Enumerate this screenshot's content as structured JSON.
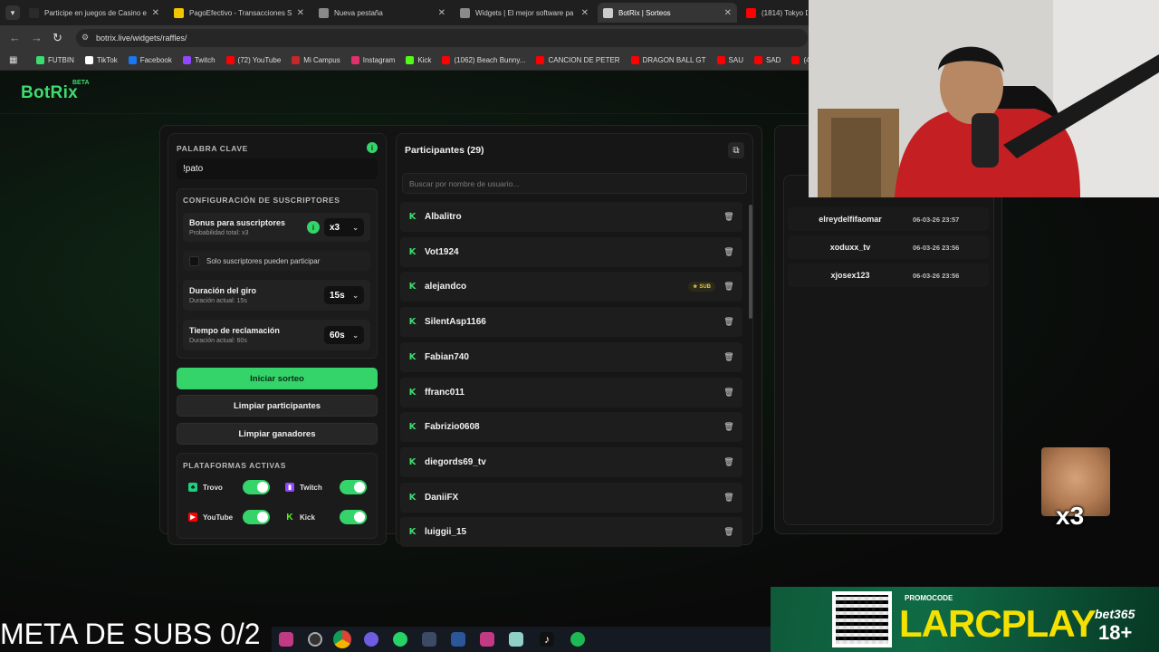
{
  "browser": {
    "tabs": [
      {
        "label": "Participe en juegos de Casino e",
        "fav_color": "#2b2b2b",
        "active": false
      },
      {
        "label": "PagoEfectivo - Transacciones S",
        "fav_color": "#f5c400",
        "active": false
      },
      {
        "label": "Nueva pestaña",
        "fav_color": "#8a8a8a",
        "active": false
      },
      {
        "label": "Widgets | El mejor software pa",
        "fav_color": "#8a8a8a",
        "active": false
      },
      {
        "label": "BotRix | Sorteos",
        "fav_color": "#cccccc",
        "active": true
      },
      {
        "label": "(1814) Tokyo D",
        "fav_color": "#ff0000",
        "active": false
      }
    ],
    "url": "botrix.live/widgets/raffles/",
    "bookmarks": [
      {
        "label": "FUTBIN",
        "color": "#3ddc6e"
      },
      {
        "label": "TikTok",
        "color": "#ffffff"
      },
      {
        "label": "Facebook",
        "color": "#1877f2"
      },
      {
        "label": "Twitch",
        "color": "#9146ff"
      },
      {
        "label": "(72) YouTube",
        "color": "#ff0000"
      },
      {
        "label": "Mi Campus",
        "color": "#c62828"
      },
      {
        "label": "Instagram",
        "color": "#e1306c"
      },
      {
        "label": "Kick",
        "color": "#53fc18"
      },
      {
        "label": "(1062) Beach Bunny...",
        "color": "#ff0000"
      },
      {
        "label": "CANCION DE PETER",
        "color": "#ff0000"
      },
      {
        "label": "DRAGON BALL GT",
        "color": "#ff0000"
      },
      {
        "label": "SAU",
        "color": "#ff0000"
      },
      {
        "label": "SAD",
        "color": "#ff0000"
      },
      {
        "label": "(463) J",
        "color": "#ff0000"
      }
    ]
  },
  "app": {
    "logo": "BotRix",
    "beta": "BETA",
    "accent": "#35d46a"
  },
  "settings": {
    "keyword_label": "PALABRA CLAVE",
    "keyword_value": "!pato",
    "subs_config_label": "CONFIGURACIÓN DE SUSCRIPTORES",
    "bonus_title": "Bonus para suscriptores",
    "bonus_sub": "Probabilidad total: x3",
    "bonus_value": "x3",
    "only_subs_label": "Solo suscriptores pueden participar",
    "spin_title": "Duración del giro",
    "spin_sub": "Duración actual: 15s",
    "spin_value": "15s",
    "claim_title": "Tiempo de reclamación",
    "claim_sub": "Duración actual: 60s",
    "claim_value": "60s",
    "start_button": "Iniciar sorteo",
    "clear_participants_button": "Limpiar participantes",
    "clear_winners_button": "Limpiar ganadores",
    "platforms_label": "PLATAFORMAS ACTIVAS",
    "platforms": [
      {
        "name": "Trovo",
        "color": "#1fcf7f",
        "on": true
      },
      {
        "name": "Twitch",
        "color": "#9146ff",
        "on": true
      },
      {
        "name": "YouTube",
        "color": "#ff0000",
        "on": true
      },
      {
        "name": "Kick",
        "color": "#53fc18",
        "on": true
      }
    ]
  },
  "participants": {
    "title": "Participantes (29)",
    "search_placeholder": "Buscar por nombre de usuario...",
    "sub_badge": "SUB",
    "list": [
      {
        "name": "Albalitro",
        "sub": false
      },
      {
        "name": "Vot1924",
        "sub": false
      },
      {
        "name": "alejandco",
        "sub": true
      },
      {
        "name": "SilentAsp1166",
        "sub": false
      },
      {
        "name": "Fabian740",
        "sub": false
      },
      {
        "name": "ffranc011",
        "sub": false
      },
      {
        "name": "Fabrizio0608",
        "sub": false
      },
      {
        "name": "diegords69_tv",
        "sub": false
      },
      {
        "name": "DaniiFX",
        "sub": false
      },
      {
        "name": "luiggii_15",
        "sub": false
      }
    ]
  },
  "winners": [
    {
      "name": "elreydelfifaomar",
      "date": "06-03-26 23:57"
    },
    {
      "name": "xoduxx_tv",
      "date": "06-03-26 23:56"
    },
    {
      "name": "xjosex123",
      "date": "06-03-26 23:56"
    }
  ],
  "overlay": {
    "meta_text": "META DE SUBS 0/2",
    "emote_label": "x3",
    "promo_label": "PROMOCODE",
    "promo_code": "LARCPLAY",
    "promo_brand": "bet365",
    "promo_age": "18+"
  }
}
